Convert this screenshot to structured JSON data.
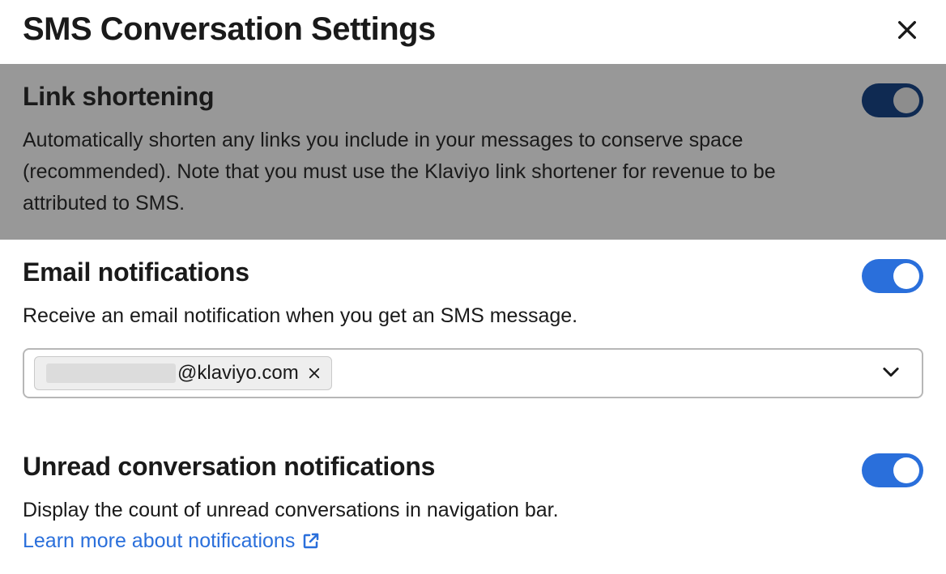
{
  "header": {
    "title": "SMS Conversation Settings"
  },
  "link_shortening": {
    "title": "Link shortening",
    "desc": "Automatically shorten any links you include in your messages to conserve space (recommended). Note that you must use the Klaviyo link shortener for revenue to be attributed to SMS.",
    "enabled": true
  },
  "email_notifications": {
    "title": "Email notifications",
    "desc": "Receive an email notification when you get an SMS message.",
    "enabled": true,
    "chip_suffix": "@klaviyo.com"
  },
  "unread_notifications": {
    "title": "Unread conversation notifications",
    "desc": "Display the count of unread conversations in navigation bar.",
    "learn_more": "Learn more about notifications",
    "enabled": true
  }
}
